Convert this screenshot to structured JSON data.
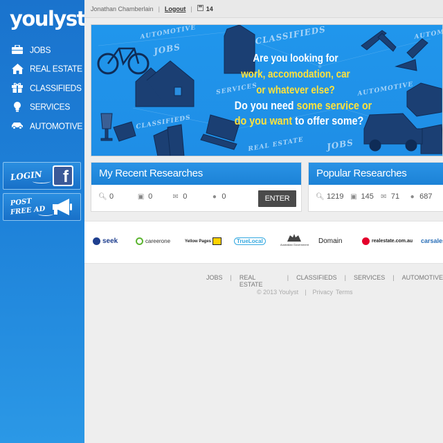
{
  "app": {
    "logo": "youlyst"
  },
  "sidebar": {
    "items": [
      {
        "label": "JOBS",
        "icon": "briefcase-icon"
      },
      {
        "label": "REAL ESTATE",
        "icon": "home-icon"
      },
      {
        "label": "CLASSIFIEDS",
        "icon": "gift-icon"
      },
      {
        "label": "SERVICES",
        "icon": "lightbulb-icon"
      },
      {
        "label": "AUTOMOTIVE",
        "icon": "car-icon"
      }
    ],
    "login_label": "LOGIN",
    "post_ad_line1": "POST",
    "post_ad_line2": "FREE AD"
  },
  "topbar": {
    "user_name": "Jonathan Chamberlain",
    "logout_label": "Logout",
    "saved_count": "14"
  },
  "banner": {
    "line1": "Are you looking for",
    "line2": "work, accomodation, car",
    "line3": "or whatever else?",
    "line4_white": "Do you need",
    "line4_yellow": "some service or",
    "line5_yellow": "do you want",
    "line5_white": "to offer some?",
    "tags": [
      "JOBS",
      "AUTOMOTIVE",
      "CLASSIFIEDS",
      "SERVICES",
      "AUTOMOTIVE",
      "CLASSIFIEDS",
      "REAL ESTATE",
      "JOBS",
      "AUTOMOTIVE"
    ]
  },
  "recent": {
    "title": "My Recent Researches",
    "stats": [
      "0",
      "0",
      "0",
      "0"
    ],
    "enter_label": "ENTER"
  },
  "popular": {
    "title": "Popular Researches",
    "stats": [
      "1219",
      "145",
      "71",
      "687"
    ]
  },
  "partners": [
    "seek",
    "careerone",
    "Yellow Pages",
    "TrueLocal",
    "Australian Government",
    "Domain",
    "realestate.com.au",
    "carsales"
  ],
  "footer": {
    "links": [
      "JOBS",
      "REAL ESTATE",
      "CLASSIFIEDS",
      "SERVICES",
      "AUTOMOTIVE"
    ],
    "copyright": "© 2013 Youlyst",
    "privacy": "Privacy",
    "terms": "Terms"
  },
  "colors": {
    "brand_blue": "#1e82d9",
    "highlight_yellow": "#ffe23c",
    "enter_button": "#4a4a4a"
  }
}
